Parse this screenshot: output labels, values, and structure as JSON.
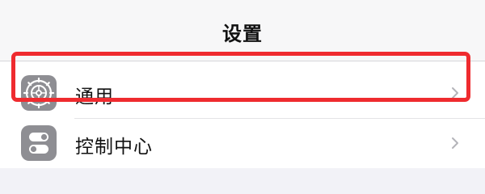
{
  "header": {
    "title": "设置"
  },
  "settings": {
    "items": [
      {
        "label": "通用",
        "icon": "gear-icon",
        "icon_color": "#8e8e93"
      },
      {
        "label": "控制中心",
        "icon": "control-center-icon",
        "icon_color": "#8e8e93"
      }
    ]
  },
  "annotation": {
    "highlight_color": "#ef2b2f"
  }
}
